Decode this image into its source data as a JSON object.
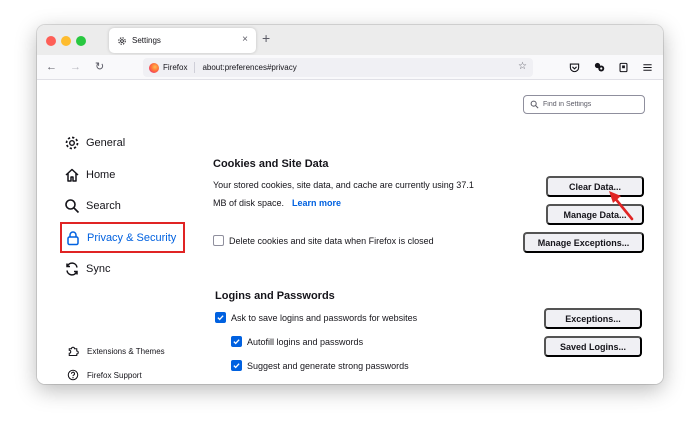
{
  "tab": {
    "title": "Settings",
    "close": "×",
    "new_tab": "+"
  },
  "nav": {
    "back": "←",
    "forward": "→",
    "reload": "↻"
  },
  "urlbar": {
    "brand": "Firefox",
    "url": "about:preferences#privacy",
    "star": "☆"
  },
  "search": {
    "placeholder": "Find in Settings"
  },
  "sidebar": {
    "categories": [
      {
        "label": "General",
        "icon": "gear-icon"
      },
      {
        "label": "Home",
        "icon": "home-icon"
      },
      {
        "label": "Search",
        "icon": "search-icon"
      },
      {
        "label": "Privacy & Security",
        "icon": "lock-icon",
        "selected": true
      },
      {
        "label": "Sync",
        "icon": "sync-icon"
      }
    ],
    "footer": [
      {
        "label": "Extensions & Themes",
        "icon": "puzzle-icon"
      },
      {
        "label": "Firefox Support",
        "icon": "help-icon"
      }
    ]
  },
  "cookies": {
    "heading": "Cookies and Site Data",
    "description_line1": "Your stored cookies, site data, and cache are currently using 37.1",
    "description_line2": "MB of disk space.",
    "learn_more": "Learn more",
    "delete_on_close": {
      "label": "Delete cookies and site data when Firefox is closed",
      "checked": false
    },
    "buttons": {
      "clear": "Clear Data...",
      "manage": "Manage Data...",
      "exceptions": "Manage Exceptions..."
    }
  },
  "logins": {
    "heading": "Logins and Passwords",
    "ask_to_save": {
      "label": "Ask to save logins and passwords for websites",
      "checked": true
    },
    "autofill": {
      "label": "Autofill logins and passwords",
      "checked": true
    },
    "suggest": {
      "label": "Suggest and generate strong passwords",
      "checked": true
    },
    "buttons": {
      "exceptions": "Exceptions...",
      "saved": "Saved Logins..."
    }
  },
  "colors": {
    "accent": "#0061e0",
    "highlight": "#e02424",
    "button_bg": "#f0f0f4"
  }
}
